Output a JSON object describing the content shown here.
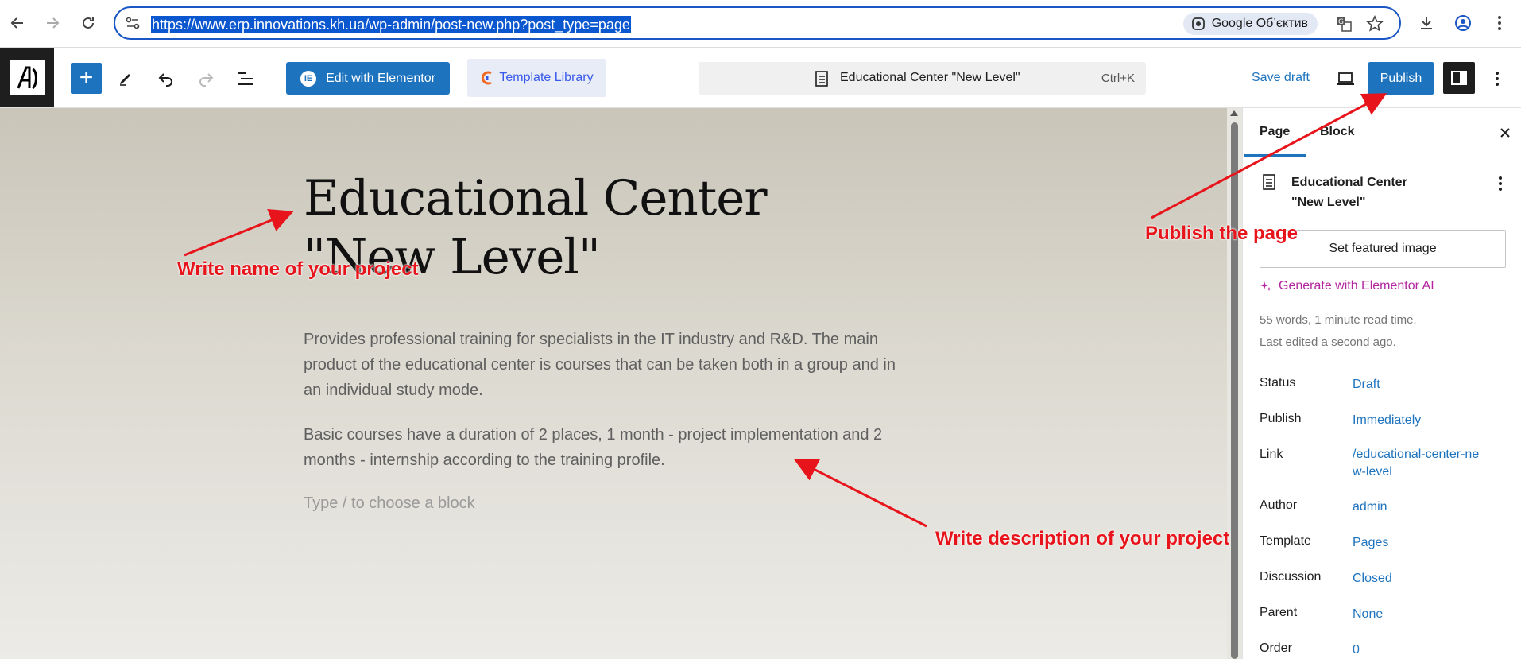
{
  "browser": {
    "url": "https://www.erp.innovations.kh.ua/wp-admin/post-new.php?post_type=page",
    "lens_label": "Google Об’єктив"
  },
  "toolbar": {
    "elementor_label": "Edit with Elementor",
    "template_library_label": "Template Library",
    "document_title": "Educational Center \"New Level\"",
    "shortcut": "Ctrl+K",
    "save_draft_label": "Save draft",
    "publish_label": "Publish",
    "accent_color": "#1e73be"
  },
  "editor": {
    "title": "Educational Center \"New Level\"",
    "paragraphs": [
      "Provides professional training for specialists in the IT industry and R&D. The main product of the educational center is courses that can be taken both in a group and in an individual study mode.",
      "Basic courses have a duration of 2 places, 1 month - project implementation and 2 months - internship according to the training profile."
    ],
    "block_placeholder": "Type / to choose a block"
  },
  "annotations": {
    "title_hint": "Write name of your project",
    "description_hint": "Write description of your project",
    "publish_hint": "Publish the page",
    "color": "#e8141b"
  },
  "sidebar": {
    "tabs": [
      "Page",
      "Block"
    ],
    "doc_title": "Educational Center \"New Level\"",
    "featured_image_label": "Set featured image",
    "generate_ai_label": "Generate with Elementor AI",
    "word_count": "55 words, 1 minute read time.",
    "last_edited": "Last edited a second ago.",
    "rows": [
      {
        "label": "Status",
        "value": "Draft"
      },
      {
        "label": "Publish",
        "value": "Immediately"
      },
      {
        "label": "Link",
        "value": "/educational-center-new-level"
      },
      {
        "label": "Author",
        "value": "admin"
      },
      {
        "label": "Template",
        "value": "Pages"
      },
      {
        "label": "Discussion",
        "value": "Closed"
      },
      {
        "label": "Parent",
        "value": "None"
      },
      {
        "label": "Order",
        "value": "0"
      }
    ]
  }
}
